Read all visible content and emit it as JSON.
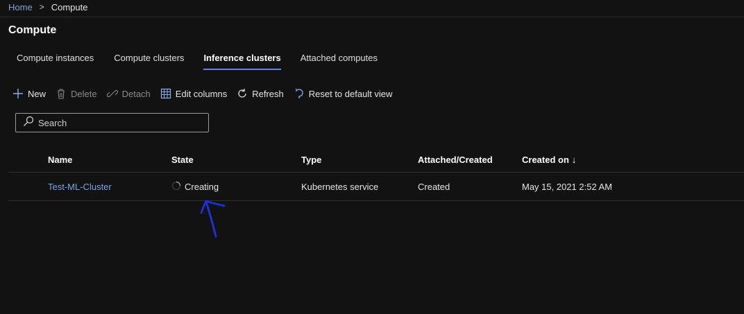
{
  "breadcrumb": {
    "home": "Home",
    "separator": ">",
    "current": "Compute"
  },
  "page": {
    "title": "Compute"
  },
  "tabs": [
    {
      "label": "Compute instances",
      "active": false
    },
    {
      "label": "Compute clusters",
      "active": false
    },
    {
      "label": "Inference clusters",
      "active": true
    },
    {
      "label": "Attached computes",
      "active": false
    }
  ],
  "toolbar": {
    "new": "New",
    "delete": "Delete",
    "detach": "Detach",
    "edit_columns": "Edit columns",
    "refresh": "Refresh",
    "reset_view": "Reset to default view"
  },
  "search": {
    "placeholder": "Search",
    "value": ""
  },
  "table": {
    "columns": [
      "Name",
      "State",
      "Type",
      "Attached/Created",
      "Created on"
    ],
    "sort_indicator": "↓",
    "rows": [
      {
        "name": "Test-ML-Cluster",
        "state": "Creating",
        "type": "Kubernetes service",
        "attached_created": "Created",
        "created_on": "May 15, 2021 2:52 AM"
      }
    ]
  },
  "colors": {
    "accent": "#6b7ff0",
    "link": "#7aa6e6",
    "annotation": "#1f2fd6",
    "background": "#121212"
  },
  "icons": [
    "plus-icon",
    "trash-icon",
    "link-icon",
    "columns-grid-icon",
    "refresh-icon",
    "reset-icon",
    "search-icon",
    "spinner-icon",
    "sort-down-icon"
  ]
}
